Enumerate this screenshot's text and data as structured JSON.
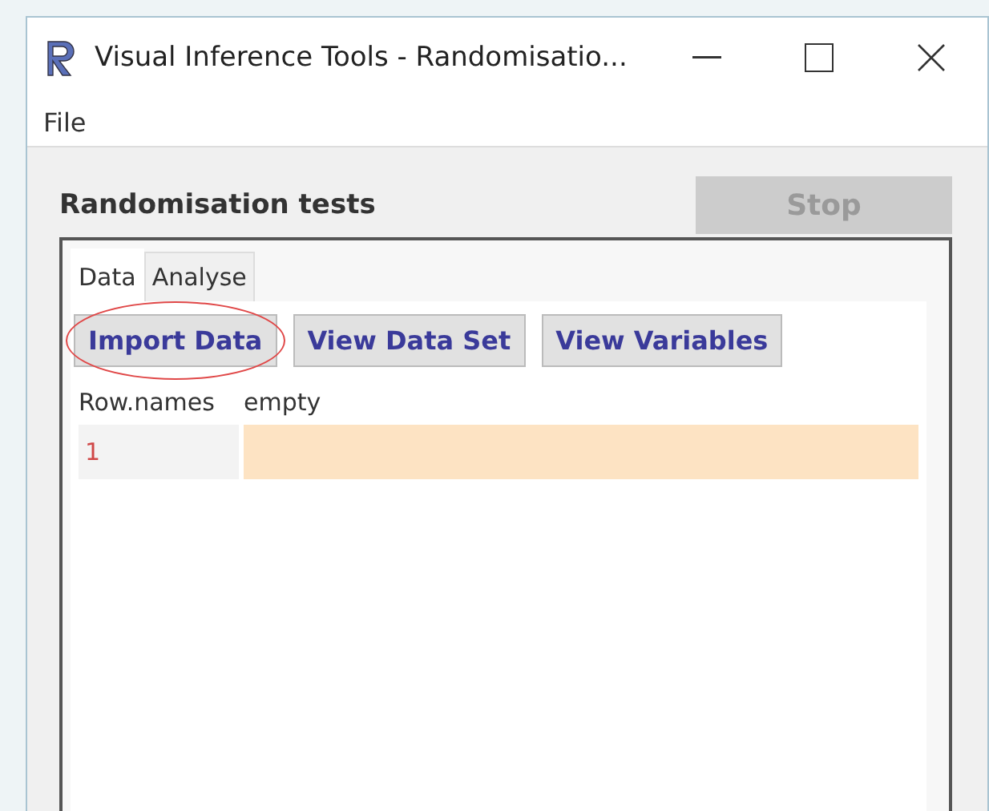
{
  "window": {
    "title": "Visual Inference Tools - Randomisatio..."
  },
  "menu": [
    "File"
  ],
  "heading": "Randomisation tests",
  "stop_button": {
    "label": "Stop",
    "disabled": true
  },
  "tabs": [
    {
      "label": "Data",
      "selected": true
    },
    {
      "label": "Analyse",
      "selected": false
    }
  ],
  "toolbar": [
    {
      "label": "Import Data",
      "circled": true
    },
    {
      "label": "View Data Set",
      "circled": false
    },
    {
      "label": "View Variables",
      "circled": false
    }
  ],
  "table": {
    "columns": [
      "Row.names",
      "empty"
    ],
    "rows": [
      {
        "name": "1",
        "cells": [
          ""
        ]
      }
    ]
  }
}
